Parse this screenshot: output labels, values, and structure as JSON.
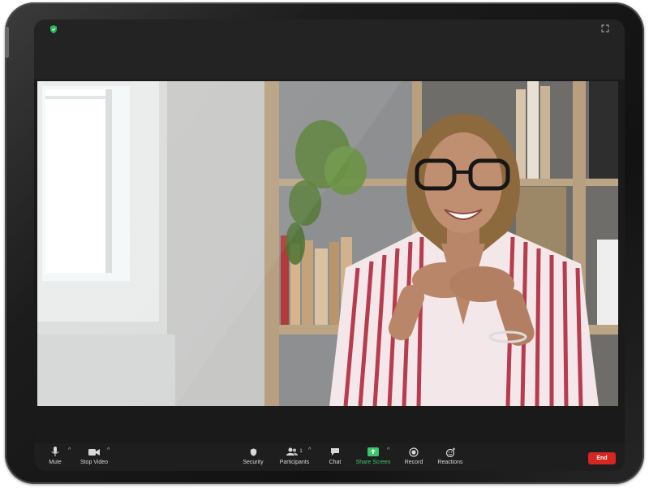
{
  "toolbar": {
    "mute": "Mute",
    "stop_video": "Stop Video",
    "security": "Security",
    "participants": "Participants",
    "participant_count": "1",
    "chat": "Chat",
    "share_screen": "Share Screen",
    "record": "Record",
    "reactions": "Reactions",
    "end": "End"
  },
  "icons": {
    "top_left": "shield-icon",
    "top_right": "fullscreen-icon",
    "mute": "microphone-icon",
    "stop_video": "video-camera-icon",
    "security": "shield-icon",
    "participants": "people-icon",
    "chat": "chat-bubble-icon",
    "share_screen": "share-arrow-icon",
    "record": "record-icon",
    "reactions": "smile-plus-icon"
  },
  "colors": {
    "share_accent": "#39c66b",
    "end_button": "#d3271f",
    "security_shield": "#2fb45a"
  }
}
